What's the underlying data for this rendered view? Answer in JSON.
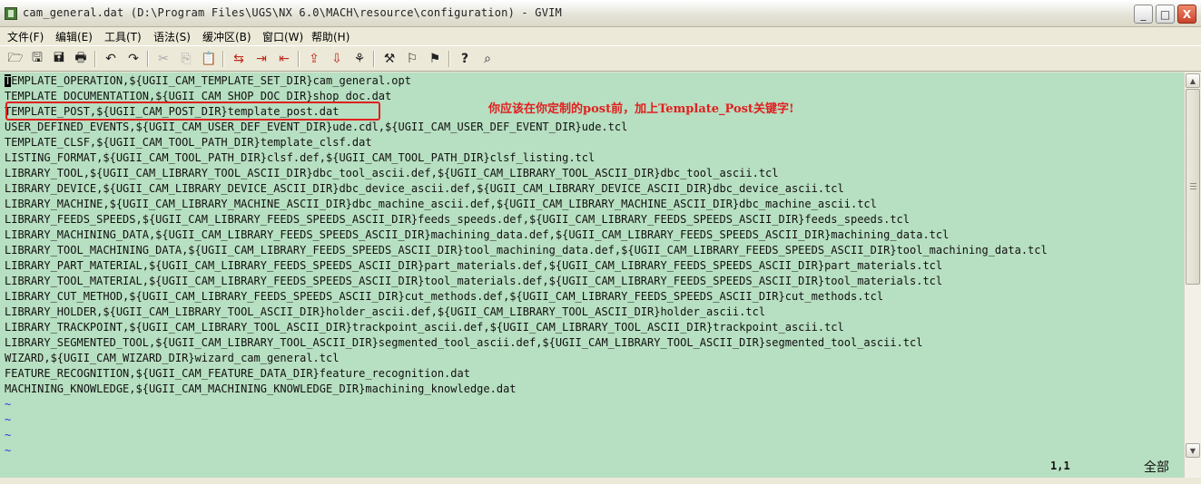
{
  "window": {
    "title": "cam_general.dat (D:\\Program Files\\UGS\\NX 6.0\\MACH\\resource\\configuration) - GVIM",
    "controls": {
      "minimize": "_",
      "maximize": "□",
      "close": "X"
    }
  },
  "menu": [
    "文件(F)",
    "编辑(E)",
    "工具(T)",
    "语法(S)",
    "缓冲区(B)",
    "窗口(W)",
    "帮助(H)"
  ],
  "toolbar": [
    {
      "icon": "open-icon",
      "glyph": "🗁"
    },
    {
      "icon": "save-icon",
      "glyph": "🖫"
    },
    {
      "icon": "save-all-icon",
      "glyph": "🖬"
    },
    {
      "icon": "print-icon",
      "glyph": "🖶"
    },
    {
      "icon": "undo-icon",
      "glyph": "↶"
    },
    {
      "icon": "redo-icon",
      "glyph": "↷"
    },
    {
      "icon": "cut-icon",
      "glyph": "✂"
    },
    {
      "icon": "copy-icon",
      "glyph": "⎘"
    },
    {
      "icon": "paste-icon",
      "glyph": "📋"
    },
    {
      "icon": "find-replace-icon",
      "glyph": "⇆"
    },
    {
      "icon": "find-next-icon",
      "glyph": "⇥"
    },
    {
      "icon": "find-prev-icon",
      "glyph": "⇤"
    },
    {
      "icon": "load-session-icon",
      "glyph": "⇪"
    },
    {
      "icon": "save-session-icon",
      "glyph": "⇩"
    },
    {
      "icon": "run-script-icon",
      "glyph": "⚘"
    },
    {
      "icon": "make-icon",
      "glyph": "⚒"
    },
    {
      "icon": "shell-icon",
      "glyph": "⚐"
    },
    {
      "icon": "tag-jump-icon",
      "glyph": "⚑"
    },
    {
      "icon": "help-icon",
      "glyph": "?"
    },
    {
      "icon": "find-help-icon",
      "glyph": "⌕"
    }
  ],
  "editor": {
    "lines": [
      "TEMPLATE_OPERATION,${UGII_CAM_TEMPLATE_SET_DIR}cam_general.opt",
      "TEMPLATE_DOCUMENTATION,${UGII_CAM_SHOP_DOC_DIR}shop_doc.dat",
      "TEMPLATE_POST,${UGII_CAM_POST_DIR}template_post.dat",
      "USER_DEFINED_EVENTS,${UGII_CAM_USER_DEF_EVENT_DIR}ude.cdl,${UGII_CAM_USER_DEF_EVENT_DIR}ude.tcl",
      "TEMPLATE_CLSF,${UGII_CAM_TOOL_PATH_DIR}template_clsf.dat",
      "LISTING_FORMAT,${UGII_CAM_TOOL_PATH_DIR}clsf.def,${UGII_CAM_TOOL_PATH_DIR}clsf_listing.tcl",
      "LIBRARY_TOOL,${UGII_CAM_LIBRARY_TOOL_ASCII_DIR}dbc_tool_ascii.def,${UGII_CAM_LIBRARY_TOOL_ASCII_DIR}dbc_tool_ascii.tcl",
      "LIBRARY_DEVICE,${UGII_CAM_LIBRARY_DEVICE_ASCII_DIR}dbc_device_ascii.def,${UGII_CAM_LIBRARY_DEVICE_ASCII_DIR}dbc_device_ascii.tcl",
      "LIBRARY_MACHINE,${UGII_CAM_LIBRARY_MACHINE_ASCII_DIR}dbc_machine_ascii.def,${UGII_CAM_LIBRARY_MACHINE_ASCII_DIR}dbc_machine_ascii.tcl",
      "LIBRARY_FEEDS_SPEEDS,${UGII_CAM_LIBRARY_FEEDS_SPEEDS_ASCII_DIR}feeds_speeds.def,${UGII_CAM_LIBRARY_FEEDS_SPEEDS_ASCII_DIR}feeds_speeds.tcl",
      "LIBRARY_MACHINING_DATA,${UGII_CAM_LIBRARY_FEEDS_SPEEDS_ASCII_DIR}machining_data.def,${UGII_CAM_LIBRARY_FEEDS_SPEEDS_ASCII_DIR}machining_data.tcl",
      "LIBRARY_TOOL_MACHINING_DATA,${UGII_CAM_LIBRARY_FEEDS_SPEEDS_ASCII_DIR}tool_machining_data.def,${UGII_CAM_LIBRARY_FEEDS_SPEEDS_ASCII_DIR}tool_machining_data.tcl",
      "LIBRARY_PART_MATERIAL,${UGII_CAM_LIBRARY_FEEDS_SPEEDS_ASCII_DIR}part_materials.def,${UGII_CAM_LIBRARY_FEEDS_SPEEDS_ASCII_DIR}part_materials.tcl",
      "LIBRARY_TOOL_MATERIAL,${UGII_CAM_LIBRARY_FEEDS_SPEEDS_ASCII_DIR}tool_materials.def,${UGII_CAM_LIBRARY_FEEDS_SPEEDS_ASCII_DIR}tool_materials.tcl",
      "LIBRARY_CUT_METHOD,${UGII_CAM_LIBRARY_FEEDS_SPEEDS_ASCII_DIR}cut_methods.def,${UGII_CAM_LIBRARY_FEEDS_SPEEDS_ASCII_DIR}cut_methods.tcl",
      "LIBRARY_HOLDER,${UGII_CAM_LIBRARY_TOOL_ASCII_DIR}holder_ascii.def,${UGII_CAM_LIBRARY_TOOL_ASCII_DIR}holder_ascii.tcl",
      "LIBRARY_TRACKPOINT,${UGII_CAM_LIBRARY_TOOL_ASCII_DIR}trackpoint_ascii.def,${UGII_CAM_LIBRARY_TOOL_ASCII_DIR}trackpoint_ascii.tcl",
      "LIBRARY_SEGMENTED_TOOL,${UGII_CAM_LIBRARY_TOOL_ASCII_DIR}segmented_tool_ascii.def,${UGII_CAM_LIBRARY_TOOL_ASCII_DIR}segmented_tool_ascii.tcl",
      "WIZARD,${UGII_CAM_WIZARD_DIR}wizard_cam_general.tcl",
      "FEATURE_RECOGNITION,${UGII_CAM_FEATURE_DATA_DIR}feature_recognition.dat",
      "MACHINING_KNOWLEDGE,${UGII_CAM_MACHINING_KNOWLEDGE_DIR}machining_knowledge.dat"
    ],
    "empty_line_markers": [
      "~",
      "~",
      "~",
      "~"
    ],
    "annotation": "你应该在你定制的post前，加上Template_Post关键字!",
    "highlighted_line_index": 2
  },
  "status": {
    "ruler": "1,1",
    "scroll_position": "全部"
  },
  "colors": {
    "editor_background": "#b7dfc1",
    "annotation": "#e02020",
    "tilde": "#2040d8"
  },
  "scrollbar": {
    "up_arrow": "▲",
    "down_arrow": "▼"
  }
}
